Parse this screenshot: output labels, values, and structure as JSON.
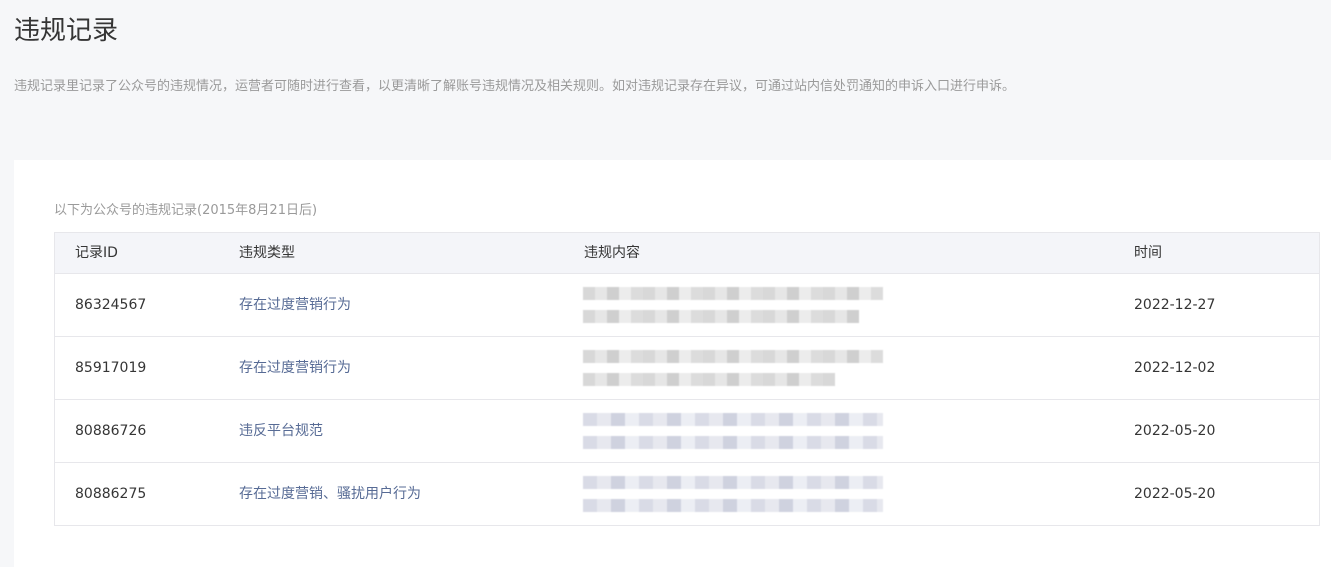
{
  "header": {
    "title": "违规记录",
    "description": "违规记录里记录了公众号的违规情况，运营者可随时进行查看，以更清晰了解账号违规情况及相关规则。如对违规记录存在异议，可通过站内信处罚通知的申诉入口进行申诉。"
  },
  "records": {
    "caption": "以下为公众号的违规记录(2015年8月21日后)",
    "columns": {
      "id": "记录ID",
      "type": "违规类型",
      "content": "违规内容",
      "time": "时间"
    },
    "rows": [
      {
        "id": "86324567",
        "type": "存在过度营销行为",
        "time": "2022-12-27"
      },
      {
        "id": "85917019",
        "type": "存在过度营销行为",
        "time": "2022-12-02"
      },
      {
        "id": "80886726",
        "type": "违反平台规范",
        "time": "2022-05-20"
      },
      {
        "id": "80886275",
        "type": "存在过度营销、骚扰用户行为",
        "time": "2022-05-20"
      }
    ]
  },
  "colors": {
    "link": "#576b95",
    "muted_text": "#9a9a9a",
    "page_bg": "#f6f7f9",
    "table_header_bg": "#f4f5f9"
  }
}
